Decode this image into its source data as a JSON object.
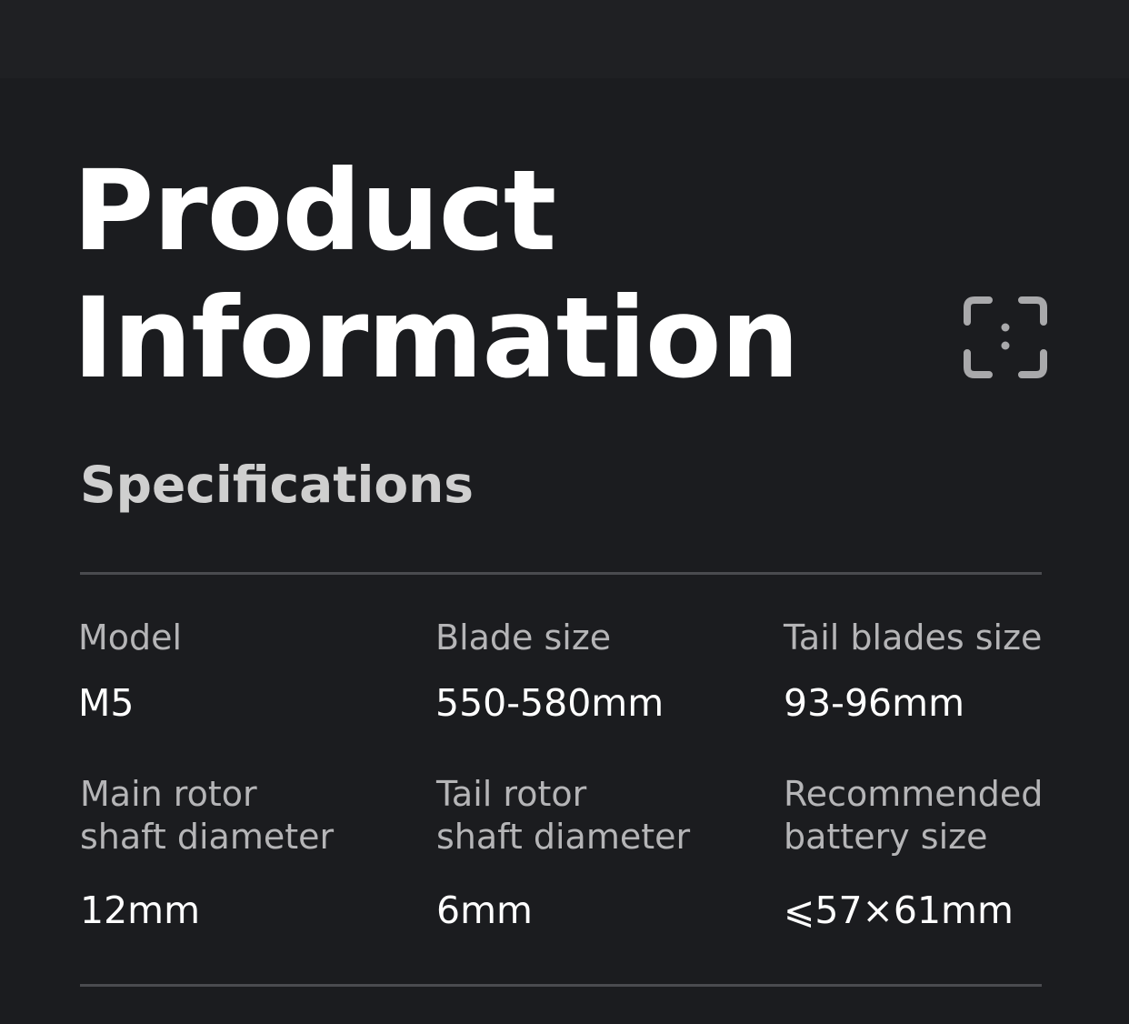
{
  "page": {
    "title_line1": "Product",
    "title_line2": "Information",
    "icon": "scan-frame-icon",
    "section_heading": "Specifications"
  },
  "colors": {
    "background": "#1b1c1f",
    "top_strip": "#1f2023",
    "title": "#ffffff",
    "heading": "#cfcfcf",
    "label": "#b5b5b7",
    "value": "#ffffff",
    "divider": "#4a4b4f",
    "icon": "#a9a9ab"
  },
  "specs": [
    {
      "label": "Model",
      "value": "M5"
    },
    {
      "label": "Blade size",
      "value": "550-580mm"
    },
    {
      "label": "Tail blades size",
      "value": "93-96mm"
    },
    {
      "label": "Main rotor\nshaft diameter",
      "value": "12mm"
    },
    {
      "label": "Tail rotor\nshaft diameter",
      "value": "6mm"
    },
    {
      "label": "Recommended\nbattery size",
      "value": "⩽57×61mm"
    }
  ]
}
